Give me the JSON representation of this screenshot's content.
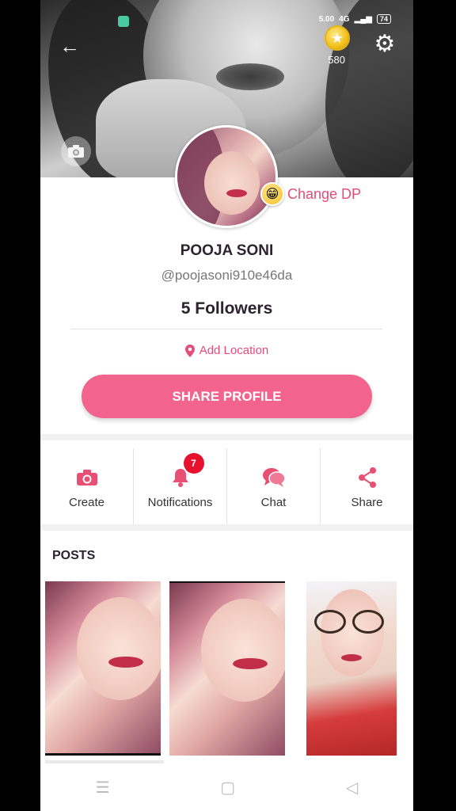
{
  "status_bar": {
    "time": "5.00",
    "network": "4G",
    "battery": "74"
  },
  "header": {
    "coin_count": "580",
    "back_icon": "back-arrow-icon",
    "settings_icon": "gear-icon",
    "cover_camera_icon": "camera-icon"
  },
  "profile": {
    "change_dp_label": "Change DP",
    "name": "POOJA SONI",
    "handle": "@poojasoni910e46da",
    "followers": "5 Followers",
    "location_label": "Add Location",
    "share_profile_label": "SHARE PROFILE"
  },
  "actions": [
    {
      "label": "Create",
      "icon": "camera-icon"
    },
    {
      "label": "Notifications",
      "icon": "bell-icon",
      "badge": "7"
    },
    {
      "label": "Chat",
      "icon": "chat-bubbles-icon"
    },
    {
      "label": "Share",
      "icon": "share-icon"
    }
  ],
  "posts": {
    "title": "POSTS"
  },
  "colors": {
    "accent": "#f2648d",
    "accent_text": "#e74c76",
    "badge": "#e8112d"
  }
}
